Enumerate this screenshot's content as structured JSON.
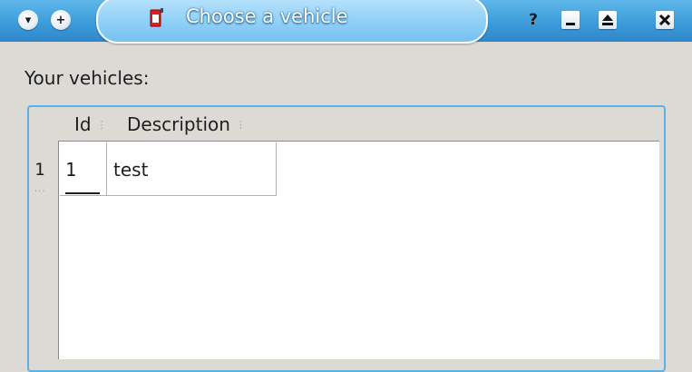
{
  "window": {
    "title": "Choose a vehicle",
    "menu_button": "▾",
    "add_button": "+",
    "help_button": "?"
  },
  "content": {
    "label": "Your vehicles:",
    "table": {
      "columns": [
        "Id",
        "Description"
      ],
      "rows": [
        {
          "header": "1",
          "id": "1",
          "description": "test"
        }
      ]
    }
  }
}
